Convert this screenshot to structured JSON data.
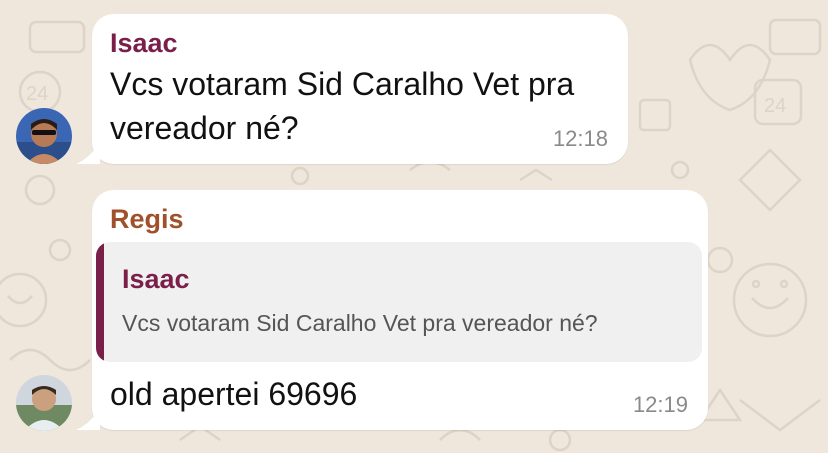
{
  "colors": {
    "background": "#efe7dc",
    "bubble": "#ffffff",
    "isaac_name": "#7a1f4a",
    "regis_name": "#a0502a",
    "quote_bar": "#7a1f4a",
    "quote_bg": "#f1f0f0",
    "timestamp": "#8a8a8a"
  },
  "messages": [
    {
      "sender": "Isaac",
      "text_line1": "Vcs votaram Sid Caralho Vet pra",
      "text_line2": "vereador né?",
      "time": "12:18",
      "avatar_icon": "isaac-avatar"
    },
    {
      "sender": "Regis",
      "quoted": {
        "sender": "Isaac",
        "text": "Vcs votaram Sid Caralho Vet pra vereador né?"
      },
      "text": "old apertei 69696",
      "time": "12:19",
      "avatar_icon": "regis-avatar"
    }
  ]
}
